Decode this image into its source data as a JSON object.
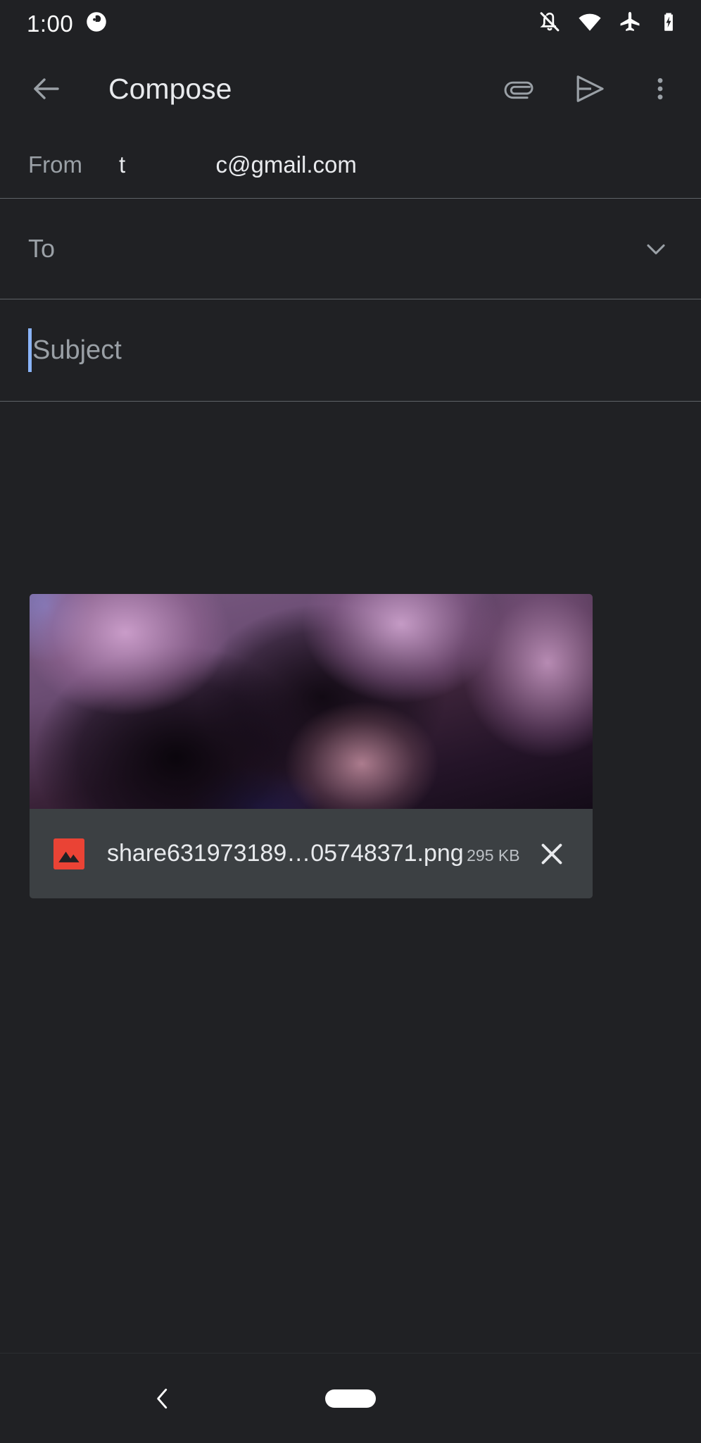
{
  "app": {
    "theme_background": "#202124",
    "accent_color": "#8ab4f8",
    "divider_color": "#5f6368"
  },
  "statusbar": {
    "time": "1:00",
    "left_icons": [
      {
        "name": "notification-badge-icon",
        "glyph": "circle-badge"
      }
    ],
    "right_icons": [
      {
        "name": "notifications-off-icon",
        "glyph": "bell-slash"
      },
      {
        "name": "wifi-icon",
        "glyph": "wifi-full"
      },
      {
        "name": "airplane-mode-icon",
        "glyph": "airplane"
      },
      {
        "name": "battery-charging-icon",
        "glyph": "battery-bolt"
      }
    ]
  },
  "appbar": {
    "back_label": "Back",
    "title": "Compose",
    "actions": [
      {
        "name": "attach-button",
        "label": "Attach file"
      },
      {
        "name": "send-button",
        "label": "Send"
      },
      {
        "name": "more-options-button",
        "label": "More options"
      }
    ]
  },
  "compose": {
    "from": {
      "label": "From",
      "value": "t              c@gmail.com"
    },
    "to": {
      "placeholder": "To",
      "value": "",
      "expand_label": "Show Cc/Bcc"
    },
    "subject": {
      "placeholder": "Subject",
      "value": "",
      "focused": true
    },
    "body": {
      "placeholder": "",
      "value": ""
    }
  },
  "attachment": {
    "file_name": "share631973189…05748371.png",
    "file_size": "295 KB",
    "icon_name": "image-file-icon",
    "icon_color": "#ea4335",
    "remove_label": "Remove attachment",
    "preview_alt": "Blurred purple abstract photo preview"
  },
  "navbar": {
    "back_label": "Back",
    "home_label": "Home"
  }
}
